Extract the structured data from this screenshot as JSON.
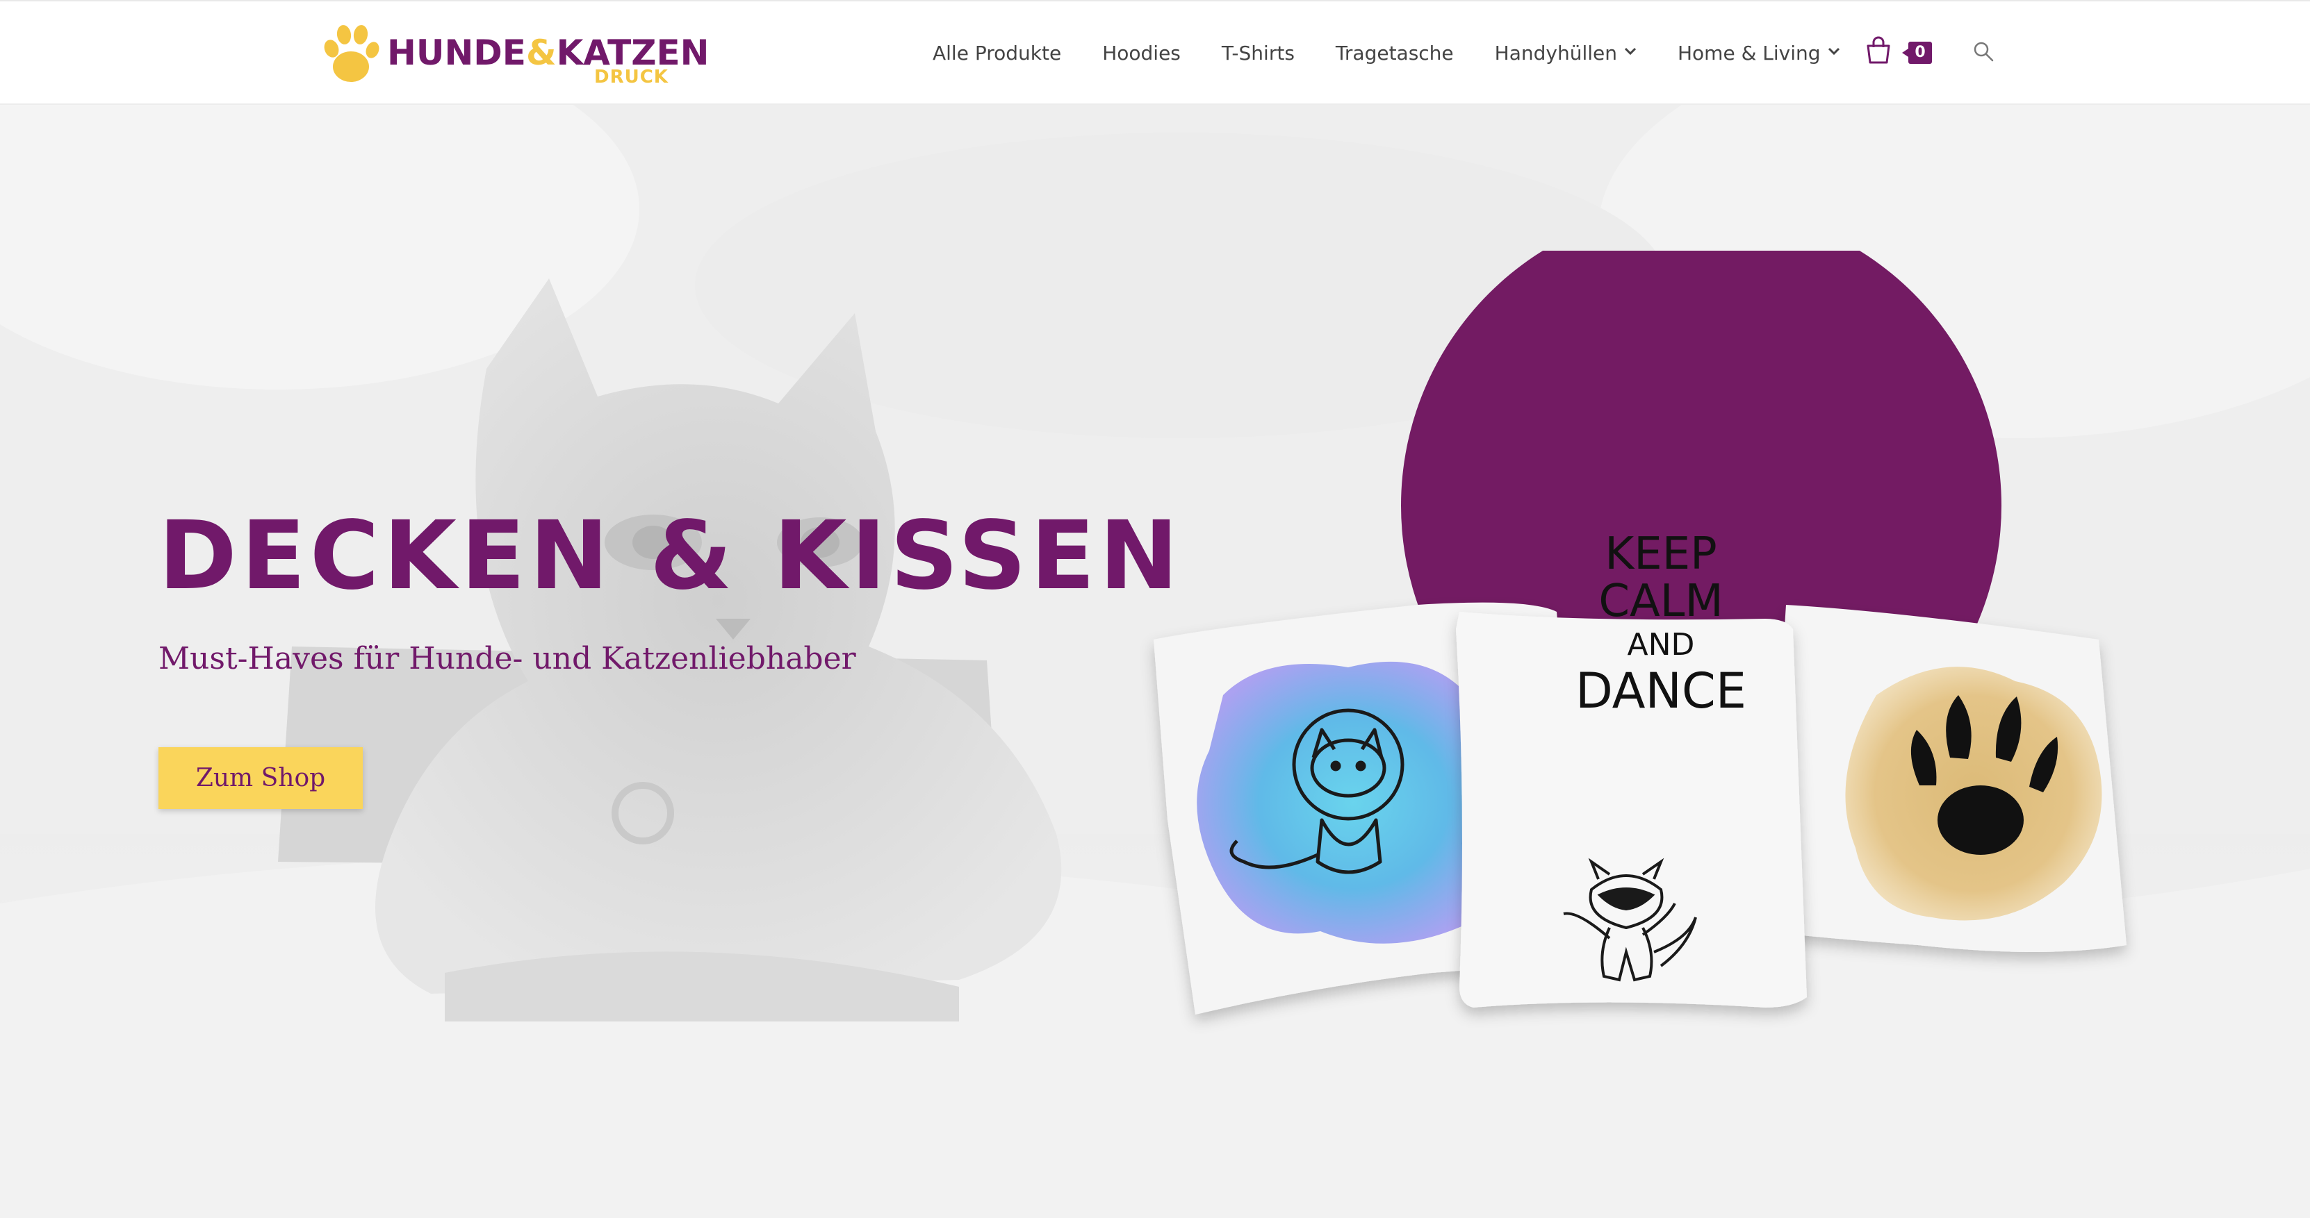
{
  "brand": {
    "name_part1": "HUNDE",
    "name_amp": "&",
    "name_part2": "KATZEN",
    "name_sub": "DRUCK",
    "primary_color": "#71196a",
    "accent_color": "#f4c542"
  },
  "nav": {
    "items": [
      {
        "label": "Alle Produkte",
        "dropdown": false
      },
      {
        "label": "Hoodies",
        "dropdown": false
      },
      {
        "label": "T-Shirts",
        "dropdown": false
      },
      {
        "label": "Tragetasche",
        "dropdown": false
      },
      {
        "label": "Handyhüllen",
        "dropdown": true
      },
      {
        "label": "Home & Living",
        "dropdown": true
      }
    ],
    "cart_count": "0",
    "cart_icon": "shopping-bag-icon",
    "search_icon": "search-icon"
  },
  "hero": {
    "title": "DECKEN & KISSEN",
    "subtitle": "Must-Haves für Hunde- und Katzenliebhaber",
    "button_label": "Zum Shop",
    "button_color": "#fad55b",
    "circle_color": "#731b63",
    "pillows": {
      "left_motif": "astronaut-cat-icon",
      "center_lines": [
        "KEEP",
        "CALM",
        "AND",
        "DANCE"
      ],
      "center_motif": "dabbing-raccoon-icon",
      "right_motif": "paw-print-icon"
    }
  }
}
